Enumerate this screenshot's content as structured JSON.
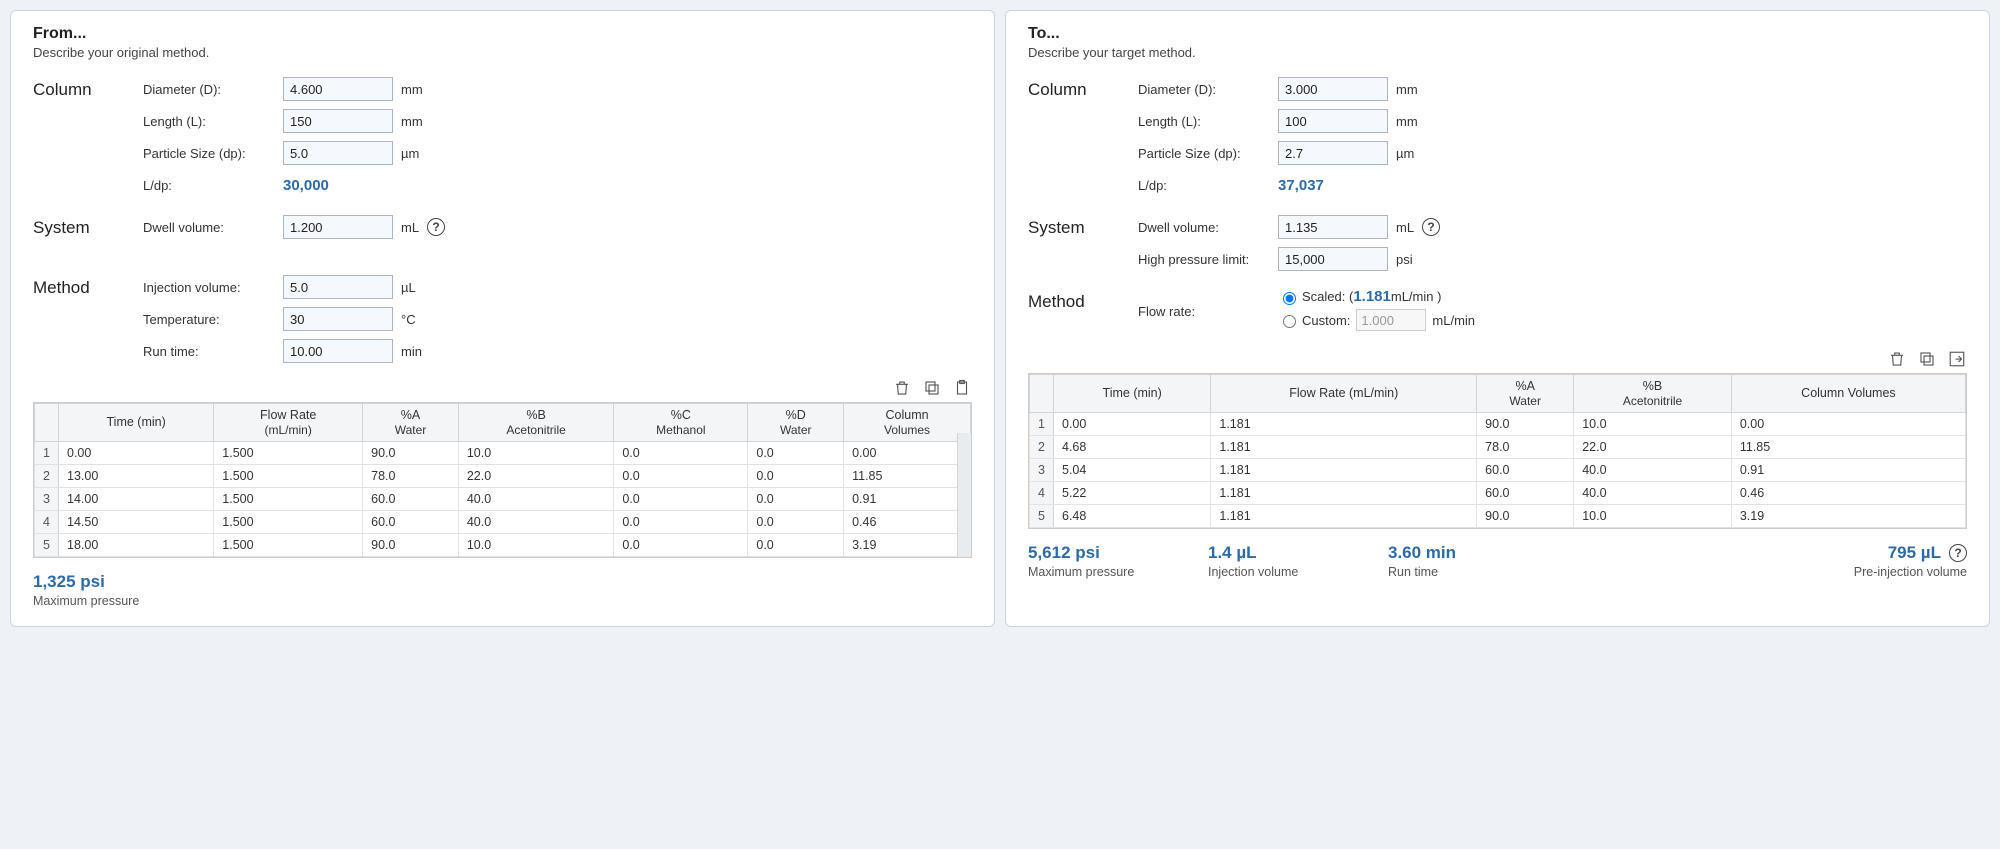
{
  "from": {
    "title": "From...",
    "subtitle": "Describe your original method.",
    "column_label": "Column",
    "system_label": "System",
    "method_label": "Method",
    "diameter_label": "Diameter (D):",
    "diameter_value": "4.600",
    "diameter_unit": "mm",
    "length_label": "Length (L):",
    "length_value": "150",
    "length_unit": "mm",
    "particle_label": "Particle Size (dp):",
    "particle_value": "5.0",
    "particle_unit": "µm",
    "ldp_label": "L/dp:",
    "ldp_value": "30,000",
    "dwell_label": "Dwell volume:",
    "dwell_value": "1.200",
    "dwell_unit": "mL",
    "inj_label": "Injection volume:",
    "inj_value": "5.0",
    "inj_unit": "µL",
    "temp_label": "Temperature:",
    "temp_value": "30",
    "temp_unit": "°C",
    "run_label": "Run time:",
    "run_value": "10.00",
    "run_unit": "min",
    "table": {
      "headers": {
        "time": "Time (min)",
        "flow_top": "Flow Rate",
        "flow_sub": "(mL/min)",
        "a_top": "%A",
        "a_sub": "Water",
        "b_top": "%B",
        "b_sub": "Acetonitrile",
        "c_top": "%C",
        "c_sub": "Methanol",
        "d_top": "%D",
        "d_sub": "Water",
        "cv_top": "Column",
        "cv_sub": "Volumes"
      },
      "rows": [
        {
          "n": "1",
          "time": "0.00",
          "flow": "1.500",
          "a": "90.0",
          "b": "10.0",
          "c": "0.0",
          "d": "0.0",
          "cv": "0.00"
        },
        {
          "n": "2",
          "time": "13.00",
          "flow": "1.500",
          "a": "78.0",
          "b": "22.0",
          "c": "0.0",
          "d": "0.0",
          "cv": "11.85"
        },
        {
          "n": "3",
          "time": "14.00",
          "flow": "1.500",
          "a": "60.0",
          "b": "40.0",
          "c": "0.0",
          "d": "0.0",
          "cv": "0.91"
        },
        {
          "n": "4",
          "time": "14.50",
          "flow": "1.500",
          "a": "60.0",
          "b": "40.0",
          "c": "0.0",
          "d": "0.0",
          "cv": "0.46"
        },
        {
          "n": "5",
          "time": "18.00",
          "flow": "1.500",
          "a": "90.0",
          "b": "10.0",
          "c": "0.0",
          "d": "0.0",
          "cv": "3.19"
        }
      ]
    },
    "summary": {
      "max_pressure_val": "1,325 psi",
      "max_pressure_lbl": "Maximum pressure"
    }
  },
  "to": {
    "title": "To...",
    "subtitle": "Describe your target method.",
    "column_label": "Column",
    "system_label": "System",
    "method_label": "Method",
    "diameter_label": "Diameter (D):",
    "diameter_value": "3.000",
    "diameter_unit": "mm",
    "length_label": "Length (L):",
    "length_value": "100",
    "length_unit": "mm",
    "particle_label": "Particle Size (dp):",
    "particle_value": "2.7",
    "particle_unit": "µm",
    "ldp_label": "L/dp:",
    "ldp_value": "37,037",
    "dwell_label": "Dwell volume:",
    "dwell_value": "1.135",
    "dwell_unit": "mL",
    "hpl_label": "High pressure limit:",
    "hpl_value": "15,000",
    "hpl_unit": "psi",
    "flow_label": "Flow rate:",
    "scaled_prefix": "Scaled: ( ",
    "scaled_value": "1.181",
    "scaled_suffix": " mL/min )",
    "custom_label": "Custom:",
    "custom_value": "1.000",
    "custom_unit": "mL/min",
    "table": {
      "headers": {
        "time": "Time (min)",
        "flow": "Flow Rate (mL/min)",
        "a_top": "%A",
        "a_sub": "Water",
        "b_top": "%B",
        "b_sub": "Acetonitrile",
        "cv": "Column Volumes"
      },
      "rows": [
        {
          "n": "1",
          "time": "0.00",
          "flow": "1.181",
          "a": "90.0",
          "b": "10.0",
          "cv": "0.00"
        },
        {
          "n": "2",
          "time": "4.68",
          "flow": "1.181",
          "a": "78.0",
          "b": "22.0",
          "cv": "11.85"
        },
        {
          "n": "3",
          "time": "5.04",
          "flow": "1.181",
          "a": "60.0",
          "b": "40.0",
          "cv": "0.91"
        },
        {
          "n": "4",
          "time": "5.22",
          "flow": "1.181",
          "a": "60.0",
          "b": "40.0",
          "cv": "0.46"
        },
        {
          "n": "5",
          "time": "6.48",
          "flow": "1.181",
          "a": "90.0",
          "b": "10.0",
          "cv": "3.19"
        }
      ]
    },
    "summary": {
      "max_pressure_val": "5,612 psi",
      "max_pressure_lbl": "Maximum pressure",
      "inj_val": "1.4  µL",
      "inj_lbl": "Injection volume",
      "run_val": "3.60  min",
      "run_lbl": "Run time",
      "pre_val": "795  µL",
      "pre_lbl": "Pre-injection volume"
    }
  },
  "help_glyph": "?"
}
